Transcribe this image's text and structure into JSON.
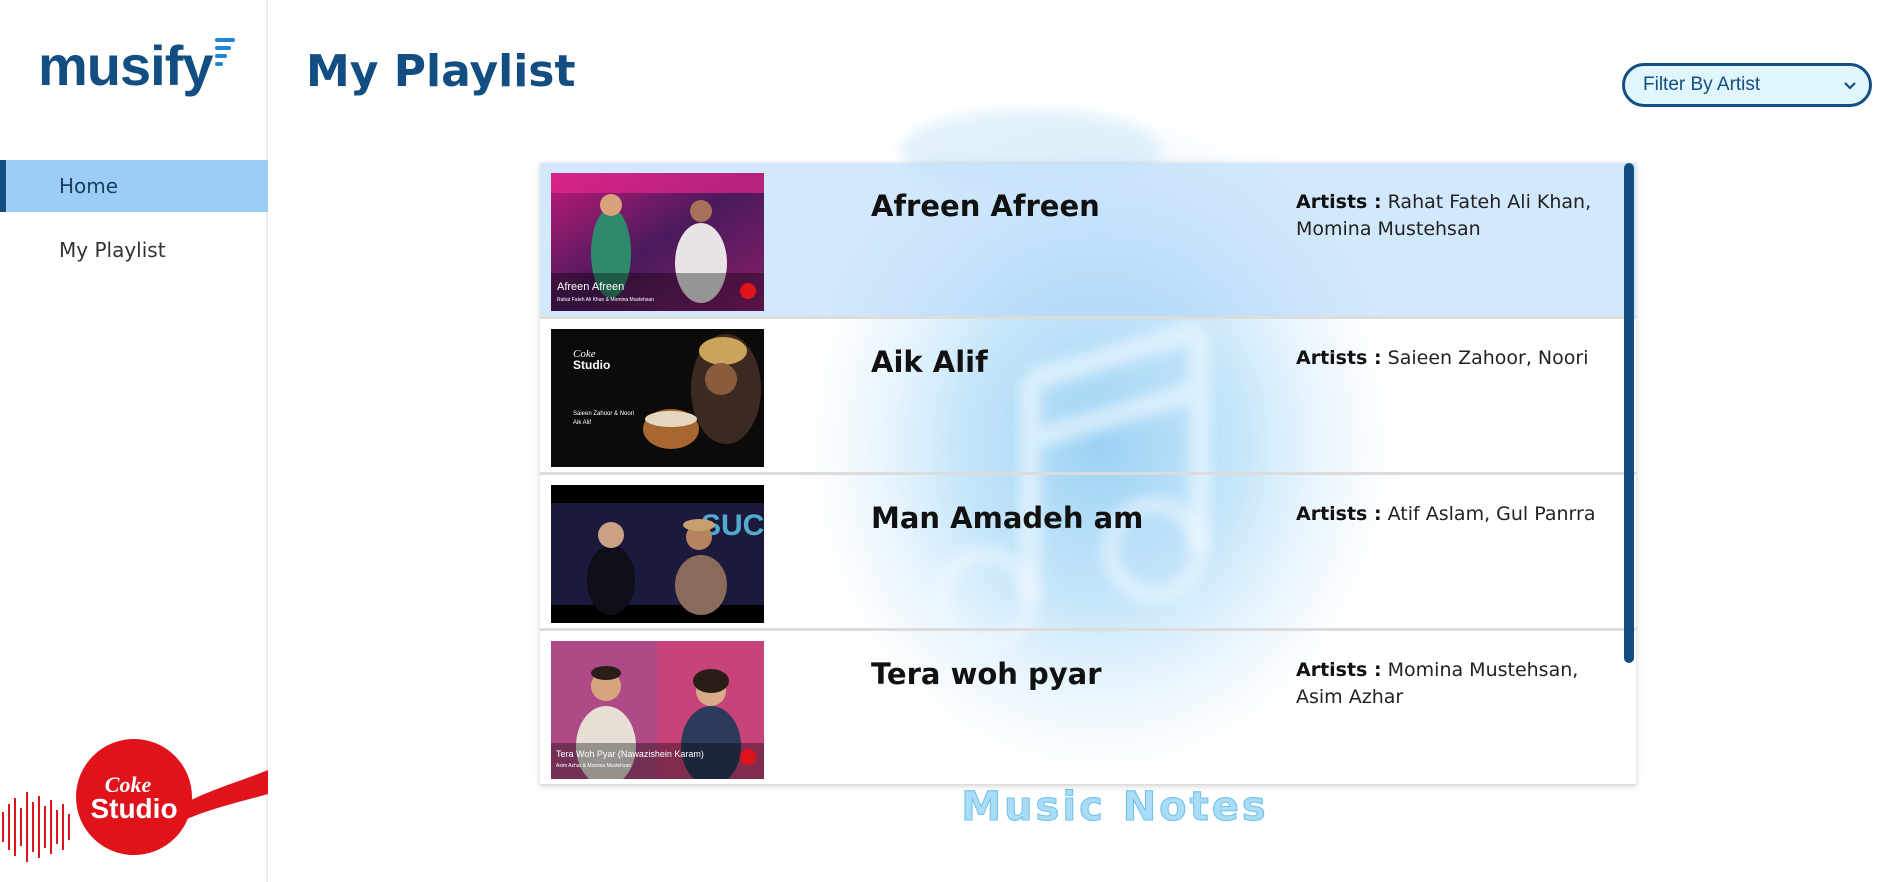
{
  "app": {
    "logo_text": "musify"
  },
  "sidebar": {
    "items": [
      {
        "label": "Home",
        "active": true
      },
      {
        "label": "My Playlist",
        "active": false
      }
    ]
  },
  "header": {
    "title": "My Playlist"
  },
  "filter": {
    "selected": "Filter By Artist"
  },
  "background": {
    "caption": "Music Notes"
  },
  "playlist": {
    "artists_label": "Artists :",
    "songs": [
      {
        "title": "Afreen Afreen",
        "artists": "Rahat Fateh Ali Khan, Momina Mustehsan",
        "thumb_caption": "Afreen Afreen",
        "thumb_sub": "Rahat Fateh Ali Khan & Momina Mustehsan"
      },
      {
        "title": "Aik Alif",
        "artists": "Saieen Zahoor, Noori",
        "thumb_caption": "Saieen Zahoor & Noori",
        "thumb_sub": "Aik Alif"
      },
      {
        "title": "Man Amadeh am",
        "artists": "Atif Aslam, Gul Panrra",
        "thumb_caption": "",
        "thumb_sub": ""
      },
      {
        "title": "Tera woh pyar",
        "artists": "Momina Mustehsan, Asim Azhar",
        "thumb_caption": "Tera Woh Pyar (Nawazishein Karam)",
        "thumb_sub": "Asim Azhar & Momina Mustehsan"
      }
    ]
  },
  "colors": {
    "brand": "#124e82",
    "active_nav": "#9ccdf7",
    "accent_red": "#e0131b"
  }
}
